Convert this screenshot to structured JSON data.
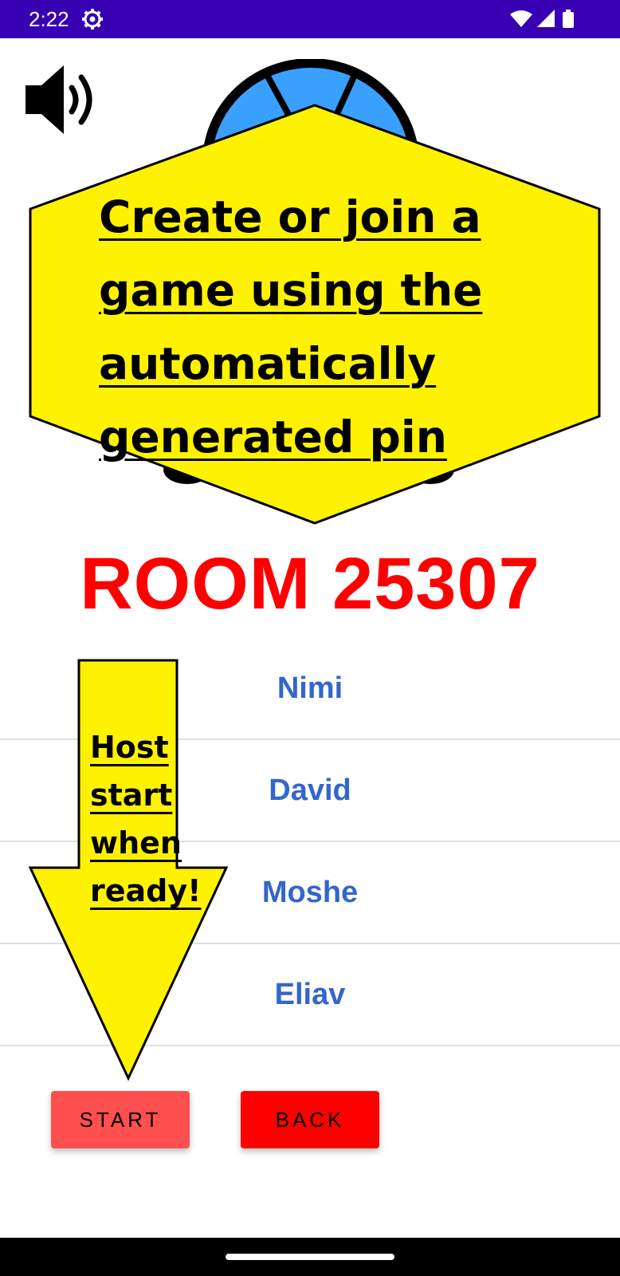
{
  "status_bar": {
    "time": "2:22",
    "settings_icon": "gear-icon",
    "wifi_icon": "wifi-icon",
    "signal_icon": "signal-icon",
    "battery_icon": "battery-icon"
  },
  "sound_icon": "speaker-icon",
  "tooltip_main": {
    "lines": [
      "Create or join a",
      "game using the",
      "automatically",
      "generated pin"
    ]
  },
  "room": {
    "title": "ROOM 25307"
  },
  "players": [
    {
      "name": "Nimi"
    },
    {
      "name": "David"
    },
    {
      "name": "Moshe"
    },
    {
      "name": "Eliav"
    }
  ],
  "tooltip_host": {
    "lines": [
      "Host",
      "start",
      "when",
      "ready!"
    ]
  },
  "buttons": {
    "start": "START",
    "back": "BACK"
  },
  "colors": {
    "status_bar": "#3700b3",
    "room_title": "#ff0000",
    "player_name": "#3366cc",
    "tooltip_fill": "#fff200",
    "start_button": "#ff4f4f",
    "back_button": "#ff0000"
  }
}
